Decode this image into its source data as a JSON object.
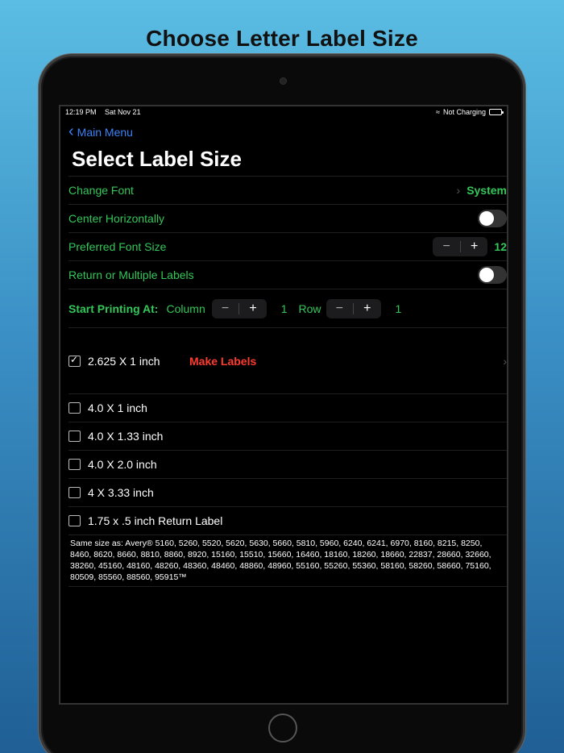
{
  "headline": "Choose Letter Label Size",
  "status": {
    "time": "12:19 PM",
    "date": "Sat Nov 21",
    "charging": "Not Charging"
  },
  "nav": {
    "back_label": "Main Menu",
    "title": "Select Label Size"
  },
  "settings": {
    "change_font_label": "Change Font",
    "change_font_value": "System",
    "center_horizontally_label": "Center Horizontally",
    "preferred_font_size_label": "Preferred Font Size",
    "preferred_font_size_value": "12",
    "return_multiple_label": "Return or Multiple Labels",
    "start_printing_label": "Start Printing At:",
    "column_label": "Column",
    "column_value": "1",
    "row_label": "Row",
    "row_value": "1"
  },
  "stepper": {
    "minus": "−",
    "plus": "+"
  },
  "selected_size": {
    "label": "2.625 X 1 inch",
    "action": "Make Labels"
  },
  "sizes": [
    "4.0 X 1 inch",
    "4.0 X 1.33 inch",
    "4.0 X 2.0 inch",
    "4 X 3.33 inch",
    "1.75 x .5 inch Return Label"
  ],
  "note": "Same size as: Avery® 5160, 5260, 5520, 5620, 5630, 5660, 5810, 5960, 6240, 6241, 6970, 8160, 8215, 8250, 8460, 8620, 8660, 8810, 8860, 8920, 15160, 15510, 15660, 16460, 18160, 18260, 18660, 22837, 28660, 32660, 38260, 45160, 48160, 48260, 48360, 48460, 48860, 48960, 55160, 55260, 55360, 58160, 58260, 58660, 75160, 80509, 85560, 88560, 95915™"
}
